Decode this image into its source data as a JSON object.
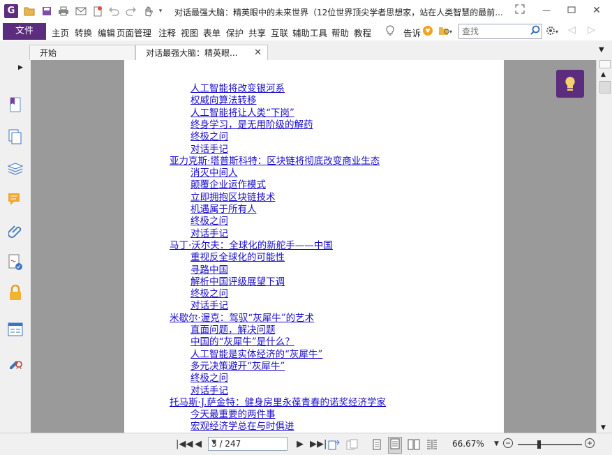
{
  "app": {
    "window_title": "对话最强大脑：精英眼中的未来世界（12位世界顶尖学者思想家，站在人类智慧的最前..."
  },
  "quick_access": [
    "app-logo",
    "open-icon",
    "save-icon",
    "print-icon",
    "email-icon",
    "new-icon",
    "undo-icon",
    "redo-icon",
    "hand-tool-icon"
  ],
  "menu": {
    "file": "文件",
    "items": [
      "主页",
      "转换",
      "编辑",
      "页面管理",
      "注释",
      "视图",
      "表单",
      "保护",
      "共享",
      "互联",
      "辅助工具",
      "帮助",
      "教程"
    ],
    "tell_me": "告诉",
    "search_placeholder": "查找"
  },
  "tabs": [
    {
      "label": "开始"
    },
    {
      "label": "对话最强大脑：精英眼..."
    }
  ],
  "toc": [
    {
      "text": "人工智能将改变银河系",
      "level": 2
    },
    {
      "text": "权威向算法转移",
      "level": 2
    },
    {
      "text": "人工智能将让人类“下岗”",
      "level": 2
    },
    {
      "text": "终身学习，是无用阶级的解药",
      "level": 2
    },
    {
      "text": "终极之问",
      "level": 2
    },
    {
      "text": "对话手记",
      "level": 2
    },
    {
      "text": "亚力克斯·塔普斯科特：区块链将彻底改变商业生态",
      "level": 1
    },
    {
      "text": "消灭中间人",
      "level": 2
    },
    {
      "text": "颠覆企业运作模式",
      "level": 2
    },
    {
      "text": "立即拥抱区块链技术",
      "level": 2
    },
    {
      "text": "机遇属于所有人",
      "level": 2
    },
    {
      "text": "终极之问",
      "level": 2
    },
    {
      "text": "对话手记",
      "level": 2
    },
    {
      "text": "马丁·沃尔夫：全球化的新舵手——中国",
      "level": 1
    },
    {
      "text": "重视反全球化的可能性",
      "level": 2
    },
    {
      "text": "寻路中国",
      "level": 2
    },
    {
      "text": "解析中国评级展望下调",
      "level": 2
    },
    {
      "text": "终极之问",
      "level": 2
    },
    {
      "text": "对话手记",
      "level": 2
    },
    {
      "text": "米歇尔·渥克：驾驭“灰犀牛”的艺术",
      "level": 1
    },
    {
      "text": "直面问题，解决问题",
      "level": 2
    },
    {
      "text": "中国的“灰犀牛”是什么？",
      "level": 2
    },
    {
      "text": "人工智能是实体经济的“灰犀牛”",
      "level": 2
    },
    {
      "text": "多元决策避开“灰犀牛”",
      "level": 2
    },
    {
      "text": "终极之问",
      "level": 2
    },
    {
      "text": "对话手记",
      "level": 2
    },
    {
      "text": "托马斯·J.萨金特：健身房里永葆青春的诺奖经济学家",
      "level": 1
    },
    {
      "text": "今天最重要的两件事",
      "level": 2
    },
    {
      "text": "宏观经济学总在与时俱进",
      "level": 2
    }
  ],
  "status": {
    "page_display": "3 / 247",
    "zoom": "66.67%",
    "zoom_fraction": 0.3
  },
  "colors": {
    "brand": "#5c2c7f",
    "link": "#1a0dcc",
    "canvas": "#9a9a9a"
  }
}
